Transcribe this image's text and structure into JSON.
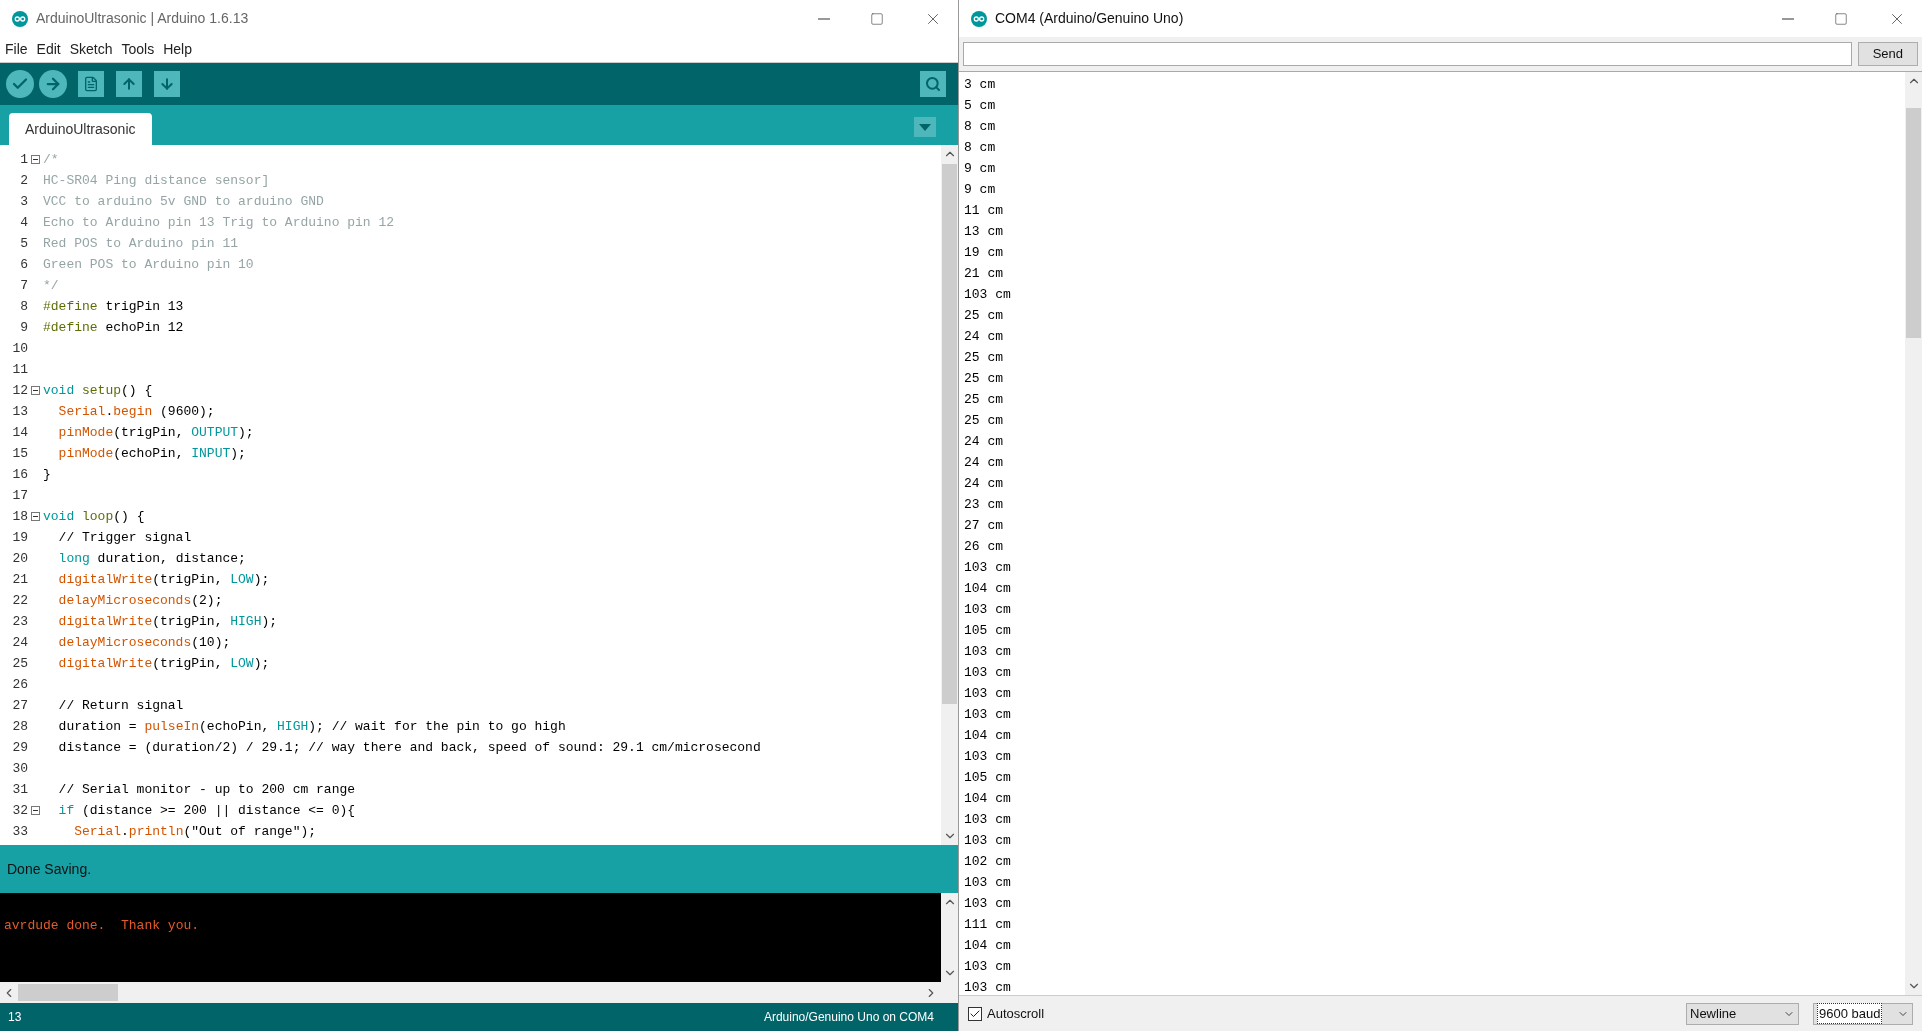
{
  "ide": {
    "title": "ArduinoUltrasonic | Arduino 1.6.13",
    "menu": [
      "File",
      "Edit",
      "Sketch",
      "Tools",
      "Help"
    ],
    "tabs": [
      {
        "label": "ArduinoUltrasonic",
        "selected": true
      }
    ],
    "code": [
      {
        "number": "1",
        "fold": true,
        "tokens": [
          {
            "kind": "comment",
            "text": "/*"
          }
        ]
      },
      {
        "number": "2",
        "fold": false,
        "tokens": [
          {
            "kind": "comment",
            "text": "HC-SR04 Ping distance sensor]"
          }
        ]
      },
      {
        "number": "3",
        "fold": false,
        "tokens": [
          {
            "kind": "comment",
            "text": "VCC to arduino 5v GND to arduino GND"
          }
        ]
      },
      {
        "number": "4",
        "fold": false,
        "tokens": [
          {
            "kind": "comment",
            "text": "Echo to Arduino pin 13 Trig to Arduino pin 12"
          }
        ]
      },
      {
        "number": "5",
        "fold": false,
        "tokens": [
          {
            "kind": "comment",
            "text": "Red POS to Arduino pin 11"
          }
        ]
      },
      {
        "number": "6",
        "fold": false,
        "tokens": [
          {
            "kind": "comment",
            "text": "Green POS to Arduino pin 10"
          }
        ]
      },
      {
        "number": "7",
        "fold": false,
        "tokens": [
          {
            "kind": "comment",
            "text": "*/"
          }
        ]
      },
      {
        "number": "8",
        "fold": false,
        "tokens": [
          {
            "kind": "preproc",
            "text": "#define"
          },
          {
            "kind": "plain",
            "text": " trigPin 13"
          }
        ]
      },
      {
        "number": "9",
        "fold": false,
        "tokens": [
          {
            "kind": "preproc",
            "text": "#define"
          },
          {
            "kind": "plain",
            "text": " echoPin 12"
          }
        ]
      },
      {
        "number": "10",
        "fold": false
      },
      {
        "number": "11",
        "fold": false
      },
      {
        "number": "12",
        "fold": true,
        "tokens": [
          {
            "kind": "keyword",
            "text": "void "
          },
          {
            "kind": "preproc",
            "text": "setup"
          },
          {
            "kind": "plain",
            "text": "() {"
          }
        ]
      },
      {
        "number": "13",
        "fold": false,
        "tokens": [
          {
            "kind": "function",
            "text": "  Serial"
          },
          {
            "kind": "plain",
            "text": "."
          },
          {
            "kind": "function",
            "text": "begin"
          },
          {
            "kind": "plain",
            "text": " (9600);"
          }
        ]
      },
      {
        "number": "14",
        "fold": false,
        "tokens": [
          {
            "kind": "function",
            "text": "  pinMode"
          },
          {
            "kind": "plain",
            "text": "(trigPin, "
          },
          {
            "kind": "constant",
            "text": "OUTPUT"
          },
          {
            "kind": "plain",
            "text": ");"
          }
        ]
      },
      {
        "number": "15",
        "fold": false,
        "tokens": [
          {
            "kind": "function",
            "text": "  pinMode"
          },
          {
            "kind": "plain",
            "text": "(echoPin, "
          },
          {
            "kind": "constant",
            "text": "INPUT"
          },
          {
            "kind": "plain",
            "text": ");"
          }
        ]
      },
      {
        "number": "16",
        "fold": false,
        "tokens": [
          {
            "kind": "plain",
            "text": "}"
          }
        ]
      },
      {
        "number": "17",
        "fold": false
      },
      {
        "number": "18",
        "fold": true,
        "tokens": [
          {
            "kind": "keyword",
            "text": "void "
          },
          {
            "kind": "preproc",
            "text": "loop"
          },
          {
            "kind": "plain",
            "text": "() {"
          }
        ]
      },
      {
        "number": "19",
        "fold": false,
        "tokens": [
          {
            "kind": "plain",
            "text": "  // Trigger signal"
          }
        ]
      },
      {
        "number": "20",
        "fold": false,
        "tokens": [
          {
            "kind": "keyword",
            "text": "  long"
          },
          {
            "kind": "plain",
            "text": " duration, distance;"
          }
        ]
      },
      {
        "number": "21",
        "fold": false,
        "tokens": [
          {
            "kind": "function",
            "text": "  digitalWrite"
          },
          {
            "kind": "plain",
            "text": "(trigPin, "
          },
          {
            "kind": "constant",
            "text": "LOW"
          },
          {
            "kind": "plain",
            "text": ");"
          }
        ]
      },
      {
        "number": "22",
        "fold": false,
        "tokens": [
          {
            "kind": "function",
            "text": "  delayMicroseconds"
          },
          {
            "kind": "plain",
            "text": "(2);"
          }
        ]
      },
      {
        "number": "23",
        "fold": false,
        "tokens": [
          {
            "kind": "function",
            "text": "  digitalWrite"
          },
          {
            "kind": "plain",
            "text": "(trigPin, "
          },
          {
            "kind": "constant",
            "text": "HIGH"
          },
          {
            "kind": "plain",
            "text": ");"
          }
        ]
      },
      {
        "number": "24",
        "fold": false,
        "tokens": [
          {
            "kind": "function",
            "text": "  delayMicroseconds"
          },
          {
            "kind": "plain",
            "text": "(10);"
          }
        ]
      },
      {
        "number": "25",
        "fold": false,
        "tokens": [
          {
            "kind": "function",
            "text": "  digitalWrite"
          },
          {
            "kind": "plain",
            "text": "(trigPin, "
          },
          {
            "kind": "constant",
            "text": "LOW"
          },
          {
            "kind": "plain",
            "text": ");"
          }
        ]
      },
      {
        "number": "26",
        "fold": false
      },
      {
        "number": "27",
        "fold": false,
        "tokens": [
          {
            "kind": "plain",
            "text": "  // Return signal"
          }
        ]
      },
      {
        "number": "28",
        "fold": false,
        "tokens": [
          {
            "kind": "plain",
            "text": "  duration = "
          },
          {
            "kind": "function",
            "text": "pulseIn"
          },
          {
            "kind": "plain",
            "text": "(echoPin, "
          },
          {
            "kind": "constant",
            "text": "HIGH"
          },
          {
            "kind": "plain",
            "text": "); // wait for the pin to go high"
          }
        ]
      },
      {
        "number": "29",
        "fold": false,
        "tokens": [
          {
            "kind": "plain",
            "text": "  distance = (duration/2) / 29.1; // way there and back, speed of sound: 29.1 cm/microsecond"
          }
        ]
      },
      {
        "number": "30",
        "fold": false
      },
      {
        "number": "31",
        "fold": false,
        "tokens": [
          {
            "kind": "plain",
            "text": "  // Serial monitor - up to 200 cm range"
          }
        ]
      },
      {
        "number": "32",
        "fold": true,
        "tokens": [
          {
            "kind": "keyword",
            "text": "  if"
          },
          {
            "kind": "plain",
            "text": " (distance >= 200 || distance <= 0){"
          }
        ]
      },
      {
        "number": "33",
        "fold": false,
        "tokens": [
          {
            "kind": "function",
            "text": "    Serial"
          },
          {
            "kind": "plain",
            "text": "."
          },
          {
            "kind": "function",
            "text": "println"
          },
          {
            "kind": "plain",
            "text": "(\"Out of range\");"
          }
        ]
      }
    ],
    "message": "Done Saving.",
    "console": [
      "avrdude done.  Thank you."
    ],
    "status_bar": {
      "line": "13",
      "board": "Arduino/Genuino Uno on COM4"
    }
  },
  "monitor": {
    "title": "COM4 (Arduino/Genuino Uno)",
    "send": "Send",
    "output": [
      "3 cm",
      "5 cm",
      "8 cm",
      "8 cm",
      "9 cm",
      "9 cm",
      "11 cm",
      "13 cm",
      "19 cm",
      "21 cm",
      "103 cm",
      "25 cm",
      "24 cm",
      "25 cm",
      "25 cm",
      "25 cm",
      "25 cm",
      "24 cm",
      "24 cm",
      "24 cm",
      "23 cm",
      "27 cm",
      "26 cm",
      "103 cm",
      "104 cm",
      "103 cm",
      "105 cm",
      "103 cm",
      "103 cm",
      "103 cm",
      "103 cm",
      "104 cm",
      "103 cm",
      "105 cm",
      "104 cm",
      "103 cm",
      "103 cm",
      "102 cm",
      "103 cm",
      "103 cm",
      "111 cm",
      "104 cm",
      "103 cm",
      "103 cm"
    ],
    "autoscroll": {
      "label": "Autoscroll",
      "checked": true
    },
    "line_ending": "Newline",
    "baud": "9600 baud"
  }
}
